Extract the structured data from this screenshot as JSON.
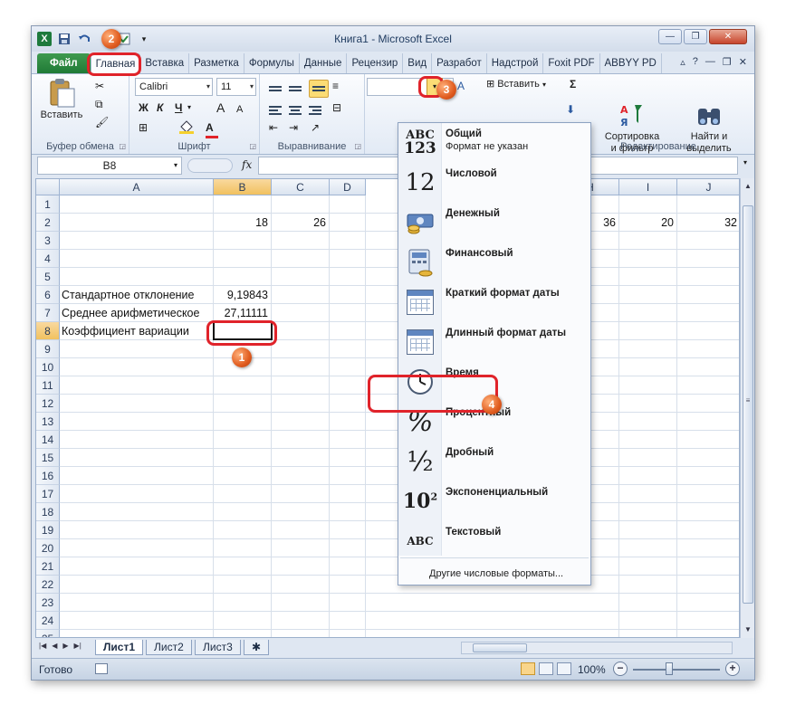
{
  "window": {
    "title": "Книга1 - Microsoft Excel"
  },
  "qat": {
    "logo": "X"
  },
  "tabs": [
    {
      "label": "Файл"
    },
    {
      "label": "Главная"
    },
    {
      "label": "Вставка"
    },
    {
      "label": "Разметка"
    },
    {
      "label": "Формулы"
    },
    {
      "label": "Данные"
    },
    {
      "label": "Рецензир"
    },
    {
      "label": "Вид"
    },
    {
      "label": "Разработ"
    },
    {
      "label": "Надстрой"
    },
    {
      "label": "Foxit PDF"
    },
    {
      "label": "ABBYY PD"
    }
  ],
  "ribbon": {
    "clipboard": {
      "paste_label": "Вставить",
      "group_label": "Буфер обмена"
    },
    "font": {
      "name": "Calibri",
      "size": "11",
      "bold": "Ж",
      "italic": "К",
      "underline": "Ч",
      "grow": "A",
      "shrink": "A",
      "group_label": "Шрифт"
    },
    "alignment": {
      "group_label": "Выравнивание"
    },
    "number": {
      "format_value": ""
    },
    "cells": {
      "insert_label": "Вставить"
    },
    "editing": {
      "sum_symbol": "Σ",
      "sort_label": "Сортировка\nи фильтр",
      "find_label": "Найти и\nвыделить",
      "group_label": "Редактирование"
    }
  },
  "formula_bar": {
    "name_box": "B8",
    "fx": "fx",
    "formula": ""
  },
  "columns": [
    "A",
    "B",
    "C",
    "D",
    "H",
    "I",
    "J"
  ],
  "rows": [
    "1",
    "2",
    "3",
    "4",
    "5",
    "6",
    "7",
    "8",
    "9",
    "10",
    "11",
    "12",
    "13",
    "14",
    "15",
    "16",
    "17",
    "18",
    "19",
    "20",
    "21",
    "22",
    "23",
    "24",
    "25"
  ],
  "cells": {
    "B2": "18",
    "C2": "26",
    "H2": "36",
    "I2": "20",
    "J2": "32",
    "A6": "Стандартное отклонение",
    "B6": "9,19843",
    "A7": "Среднее арифметическое",
    "B7": "27,11111",
    "A8": "Коэффициент вариации"
  },
  "number_formats": [
    {
      "label": "Общий",
      "sub": "Формат не указан",
      "icon": "general-format-icon",
      "glyph": "ABC\n123"
    },
    {
      "label": "Числовой",
      "sub": "",
      "icon": "number-format-icon",
      "glyph": "12"
    },
    {
      "label": "Денежный",
      "sub": "",
      "icon": "currency-format-icon",
      "glyph": ""
    },
    {
      "label": "Финансовый",
      "sub": "",
      "icon": "accounting-format-icon",
      "glyph": ""
    },
    {
      "label": "Краткий формат даты",
      "sub": "",
      "icon": "short-date-icon",
      "glyph": ""
    },
    {
      "label": "Длинный формат даты",
      "sub": "",
      "icon": "long-date-icon",
      "glyph": ""
    },
    {
      "label": "Время",
      "sub": "",
      "icon": "clock-icon",
      "glyph": ""
    },
    {
      "label": "Процентный",
      "sub": "",
      "icon": "percent-icon",
      "glyph": "%"
    },
    {
      "label": "Дробный",
      "sub": "",
      "icon": "fraction-icon",
      "glyph": "½"
    },
    {
      "label": "Экспоненциальный",
      "sub": "",
      "icon": "scientific-icon",
      "glyph": "10²"
    },
    {
      "label": "Текстовый",
      "sub": "",
      "icon": "text-format-icon",
      "glyph": "ABC"
    }
  ],
  "more_formats": "Другие числовые форматы...",
  "sheets": [
    "Лист1",
    "Лист2",
    "Лист3"
  ],
  "status": {
    "ready": "Готово",
    "zoom": "100%"
  },
  "callouts": [
    "1",
    "2",
    "3",
    "4"
  ],
  "colors": {
    "accent_red": "#e0232a",
    "file_tab": "#1f7a36",
    "selection": "#f1c15f"
  }
}
